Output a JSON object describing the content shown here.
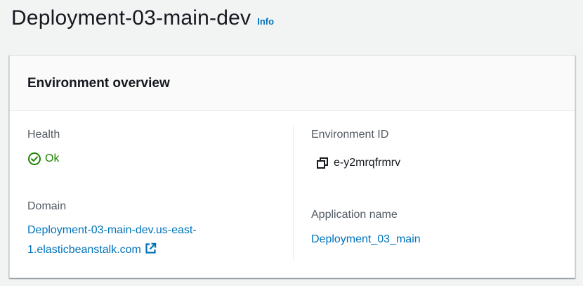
{
  "header": {
    "title": "Deployment-03-main-dev",
    "info_label": "Info"
  },
  "panel": {
    "title": "Environment overview",
    "health": {
      "label": "Health",
      "value": "Ok",
      "icon": "check-circle-icon",
      "color": "#1d8102"
    },
    "domain": {
      "label": "Domain",
      "value_line1": "Deployment-03-main-dev.us-east-",
      "value_line2": "1.elasticbeanstalk.com",
      "icon": "external-link-icon"
    },
    "environment_id": {
      "label": "Environment ID",
      "value": "e-y2mrqfrmrv",
      "icon": "copy-icon"
    },
    "application_name": {
      "label": "Application name",
      "value": "Deployment_03_main"
    }
  },
  "colors": {
    "link": "#0073bb",
    "background": "#f2f3f3",
    "text": "#16191f",
    "label": "#545b64"
  }
}
